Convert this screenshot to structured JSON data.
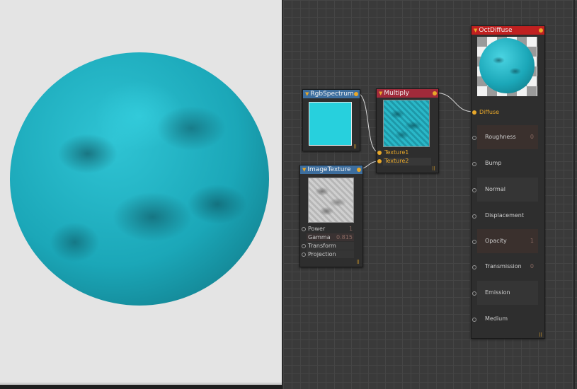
{
  "colors": {
    "accent": "#e8a82a",
    "sphere": "#1ba7b8",
    "spectrum": "#27d0dd",
    "header_blue": "#3d6e9e",
    "header_red": "#a02a3a",
    "header_octane": "#c02020"
  },
  "nodes": {
    "rgb": {
      "title": "RgbSpectrum"
    },
    "multiply": {
      "title": "Multiply",
      "inputs": [
        "Texture1",
        "Texture2"
      ]
    },
    "image": {
      "title": "ImageTexture",
      "params": [
        {
          "label": "Power",
          "value": "1"
        },
        {
          "label": "Gamma",
          "value": "0.815"
        },
        {
          "label": "Transform",
          "value": ""
        },
        {
          "label": "Projection",
          "value": ""
        }
      ]
    },
    "oct": {
      "title": "OctDiffuse",
      "diffuse": "Diffuse",
      "pins": [
        {
          "label": "Roughness",
          "value": "0"
        },
        {
          "label": "Bump",
          "value": ""
        },
        {
          "label": "Normal",
          "value": ""
        },
        {
          "label": "Displacement",
          "value": ""
        },
        {
          "label": "Opacity",
          "value": "1"
        },
        {
          "label": "Transmission",
          "value": "0"
        },
        {
          "label": "Emission",
          "value": ""
        },
        {
          "label": "Medium",
          "value": ""
        }
      ]
    }
  }
}
